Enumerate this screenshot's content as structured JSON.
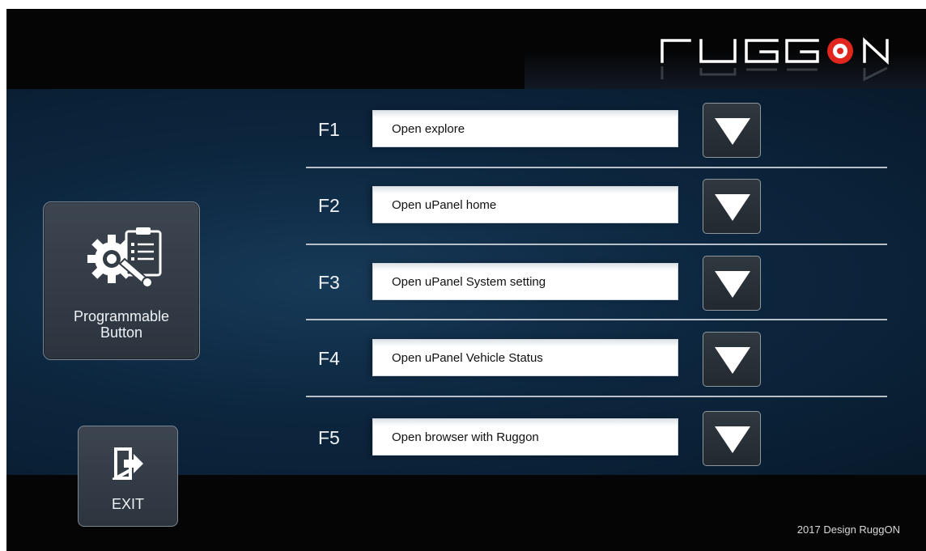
{
  "brand": {
    "name": "RUGGON"
  },
  "sidebar": {
    "programmable_button": {
      "label_line1": "Programmable",
      "label_line2": "Button",
      "icon": "gear-clipboard-icon"
    },
    "exit_button": {
      "label": "EXIT",
      "icon": "exit-icon"
    }
  },
  "functions": [
    {
      "key": "F1",
      "action": "Open explore"
    },
    {
      "key": "F2",
      "action": "Open uPanel home"
    },
    {
      "key": "F3",
      "action": "Open uPanel System setting"
    },
    {
      "key": "F4",
      "action": "Open uPanel Vehicle Status"
    },
    {
      "key": "F5",
      "action": "Open browser with Ruggon"
    }
  ],
  "footer": {
    "text": "2017 Design RuggON"
  },
  "colors": {
    "accent_red": "#e0261d",
    "background": "#0d2740",
    "bar": "#050505"
  }
}
